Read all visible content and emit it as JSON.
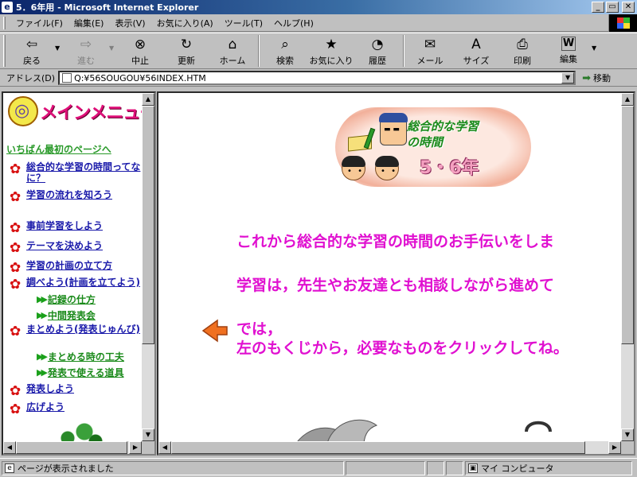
{
  "window": {
    "title": "5．6年用 - Microsoft Internet Explorer",
    "app_icon": "ie-icon"
  },
  "menubar": {
    "items": [
      "ファイル(F)",
      "編集(E)",
      "表示(V)",
      "お気に入り(A)",
      "ツール(T)",
      "ヘルプ(H)"
    ]
  },
  "toolbar": {
    "buttons": [
      {
        "label": "戻る",
        "icon": "back-arrow-icon",
        "glyph": "⇦"
      },
      {
        "label": "進む",
        "icon": "forward-arrow-icon",
        "glyph": "⇨",
        "disabled": true
      },
      {
        "label": "中止",
        "icon": "stop-icon",
        "glyph": "⊗"
      },
      {
        "label": "更新",
        "icon": "refresh-icon",
        "glyph": "↻"
      },
      {
        "label": "ホーム",
        "icon": "home-icon",
        "glyph": "⌂"
      },
      {
        "label": "検索",
        "icon": "search-icon",
        "glyph": "⌕"
      },
      {
        "label": "お気に入り",
        "icon": "favorites-icon",
        "glyph": "★"
      },
      {
        "label": "履歴",
        "icon": "history-icon",
        "glyph": "◔"
      },
      {
        "label": "メール",
        "icon": "mail-icon",
        "glyph": "✉"
      },
      {
        "label": "サイズ",
        "icon": "font-size-icon",
        "glyph": "A"
      },
      {
        "label": "印刷",
        "icon": "print-icon",
        "glyph": "⎙"
      },
      {
        "label": "編集",
        "icon": "edit-icon",
        "glyph": "W"
      }
    ]
  },
  "address": {
    "label": "アドレス(D)",
    "value": "Q:¥56SOUGOU¥56INDEX.HTM",
    "go_label": "移動"
  },
  "left_menu": {
    "title": "メインメニュー",
    "top_link": "いちばん最初のページへ",
    "items": [
      "総合的な学習の時間ってなに？",
      "学習の流れを知ろう",
      "事前学習をしよう",
      "テーマを決めよう",
      "学習の計画の立て方",
      "調べよう(計画を立てよう)",
      "まとめよう(発表じゅんび)",
      "発表しよう",
      "広げよう"
    ],
    "sub_items": [
      "記録の仕方",
      "中間発表会",
      "まとめる時の工夫",
      "発表で使える道具"
    ]
  },
  "banner": {
    "line1": "総合的な学習",
    "line2": "の時間",
    "grade": "5・6年"
  },
  "messages": {
    "line1": "これから総合的な学習の時間のお手伝いをしま",
    "line2": "学習は，先生やお友達とも相談しながら進めて",
    "line3": "では，",
    "line4": "左のもくじから，必要なものをクリックしてね。"
  },
  "status": {
    "text": "ページが表示されました",
    "zone": "マイ コンピュータ"
  },
  "colors": {
    "titlebar": "#0a246a",
    "message": "#e010d0",
    "menu_link": "#1a1aaa",
    "sub_link": "#1a8a1a",
    "flower": "#d81010",
    "pointer": "#f07020"
  }
}
